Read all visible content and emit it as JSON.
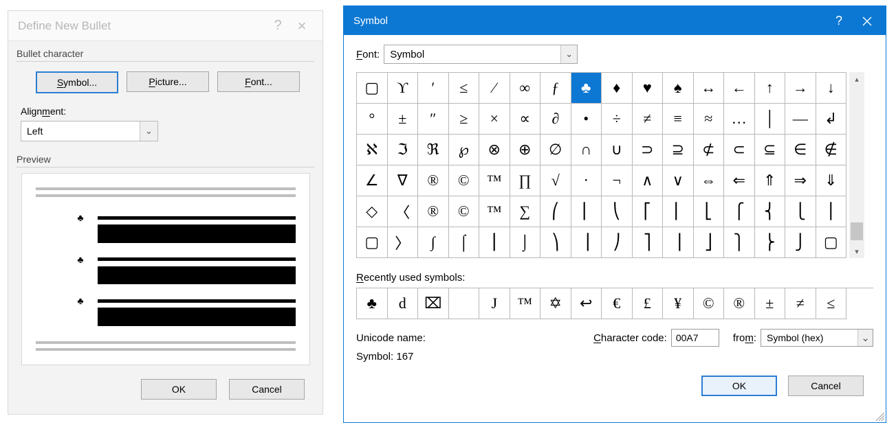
{
  "dialog1": {
    "title": "Define New Bullet",
    "section_bullet_char": "Bullet character",
    "btn_symbol": "Symbol...",
    "btn_picture": "Picture...",
    "btn_font": "Font...",
    "alignment_label": "Alignment:",
    "alignment_value": "Left",
    "section_preview": "Preview",
    "preview_bullet_glyph": "♣",
    "ok": "OK",
    "cancel": "Cancel"
  },
  "dialog2": {
    "title": "Symbol",
    "font_label": "Font:",
    "font_value": "Symbol",
    "grid": [
      [
        "▢",
        "ϒ",
        "′",
        "≤",
        "⁄",
        "∞",
        "ƒ",
        "♣",
        "♦",
        "♥",
        "♠",
        "↔",
        "←",
        "↑",
        "→",
        "↓"
      ],
      [
        "°",
        "±",
        "″",
        "≥",
        "×",
        "∝",
        "∂",
        "•",
        "÷",
        "≠",
        "≡",
        "≈",
        "…",
        "│",
        "—",
        "↲"
      ],
      [
        "ℵ",
        "ℑ",
        "ℜ",
        "℘",
        "⊗",
        "⊕",
        "∅",
        "∩",
        "∪",
        "⊃",
        "⊇",
        "⊄",
        "⊂",
        "⊆",
        "∈",
        "∉"
      ],
      [
        "∠",
        "∇",
        "®",
        "©",
        "™",
        "∏",
        "√",
        "⋅",
        "¬",
        "∧",
        "∨",
        "⇔",
        "⇐",
        "⇑",
        "⇒",
        "⇓"
      ],
      [
        "◇",
        "〈",
        "®",
        "©",
        "™",
        "∑",
        "⎛",
        "⎜",
        "⎝",
        "⎡",
        "⎢",
        "⎣",
        "⎧",
        "⎨",
        "⎩",
        "⎪"
      ],
      [
        "▢",
        "〉",
        "∫",
        "⌠",
        "⎮",
        "⌡",
        "⎞",
        "⎟",
        "⎠",
        "⎤",
        "⎥",
        "⎦",
        "⎫",
        "⎬",
        "⎭",
        "▢"
      ]
    ],
    "selected_row": 0,
    "selected_col": 7,
    "recent_label": "Recently used symbols:",
    "recent": [
      "♣",
      "d",
      "⌧",
      " ",
      "J",
      "™",
      "✡",
      "↩",
      "€",
      "£",
      "¥",
      "©",
      "®",
      "±",
      "≠",
      "≤"
    ],
    "unicode_name_label": "Unicode name:",
    "unicode_name_value": "Symbol: 167",
    "char_code_label": "Character code:",
    "char_code_value": "00A7",
    "from_label": "from:",
    "from_value": "Symbol (hex)",
    "ok": "OK",
    "cancel": "Cancel"
  }
}
